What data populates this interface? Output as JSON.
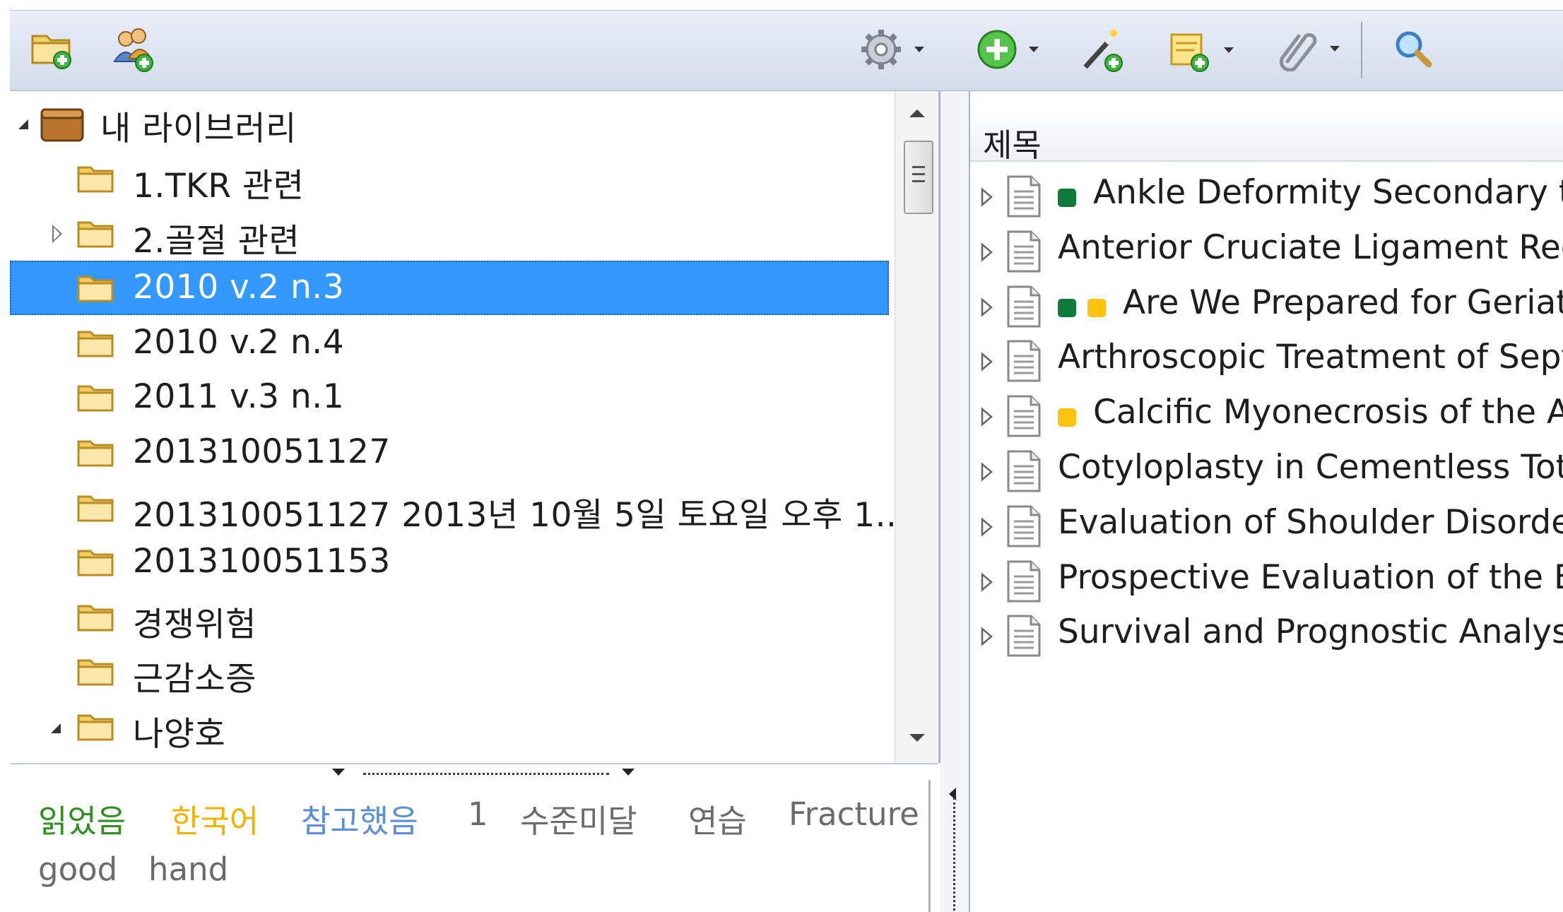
{
  "toolbar": {
    "left_buttons": [
      "new-collection-icon",
      "new-group-icon"
    ],
    "right_buttons": [
      "gear-icon",
      "add-item-icon",
      "wand-icon",
      "new-note-icon",
      "attachment-icon",
      "search-icon"
    ]
  },
  "tree": {
    "root_label": "내 라이브러리",
    "items": [
      {
        "label": "1.TKR 관련",
        "expander": "none"
      },
      {
        "label": "2.골절 관련",
        "expander": "closed"
      },
      {
        "label": "2010 v.2 n.3",
        "expander": "none",
        "selected": true
      },
      {
        "label": "2010 v.2 n.4",
        "expander": "none"
      },
      {
        "label": "2011 v.3 n.1",
        "expander": "none"
      },
      {
        "label": "201310051127",
        "expander": "none"
      },
      {
        "label": "201310051127 2013년 10월 5일 토요일 오후 1...",
        "expander": "none"
      },
      {
        "label": "201310051153",
        "expander": "none"
      },
      {
        "label": "경쟁위험",
        "expander": "none"
      },
      {
        "label": "근감소증",
        "expander": "none"
      },
      {
        "label": "나양호",
        "expander": "open"
      }
    ]
  },
  "tags": {
    "items": [
      {
        "label": "읽었음",
        "color": "#2f8f1f"
      },
      {
        "label": "한국어",
        "color": "#f0b400"
      },
      {
        "label": "참고했음",
        "color": "#5b8fd6"
      },
      {
        "label": "1",
        "color": "#6b6b6b"
      },
      {
        "label": "수준미달",
        "color": "#6b6b6b"
      },
      {
        "label": "연습",
        "color": "#6b6b6b"
      },
      {
        "label": "Fracture",
        "color": "#6b6b6b"
      },
      {
        "label": "good",
        "color": "#6b6b6b"
      },
      {
        "label": "hand",
        "color": "#6b6b6b"
      }
    ]
  },
  "items": {
    "column_header": "제목",
    "rows": [
      {
        "title": "Ankle Deformity Secondary to A",
        "colors": [
          "#0e7a3a"
        ]
      },
      {
        "title": "Anterior Cruciate Ligament Recon",
        "colors": []
      },
      {
        "title": "Are We Prepared for Geriatric",
        "colors": [
          "#0e7a3a",
          "#ffc20e"
        ]
      },
      {
        "title": "Arthroscopic Treatment of Septic A",
        "colors": []
      },
      {
        "title": "Calcific Myonecrosis of the Ante",
        "colors": [
          "#ffc20e"
        ]
      },
      {
        "title": "Cotyloplasty in Cementless Total H",
        "colors": []
      },
      {
        "title": "Evaluation of Shoulder Disorders b",
        "colors": []
      },
      {
        "title": "Prospective Evaluation of the Effec",
        "colors": []
      },
      {
        "title": "Survival and Prognostic Analysis o",
        "colors": []
      }
    ]
  }
}
